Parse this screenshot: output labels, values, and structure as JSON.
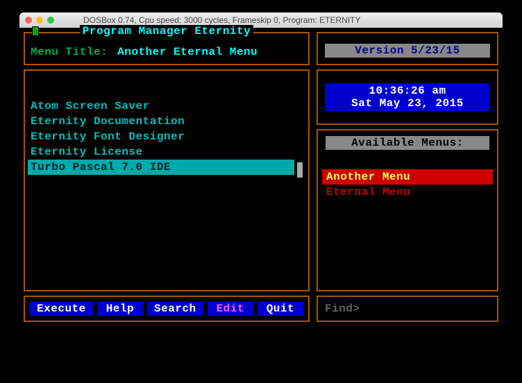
{
  "window": {
    "title": "DOSBox 0.74, Cpu speed:    3000 cycles, Frameskip  0, Program: ETERNITY"
  },
  "header": {
    "panel_title": "Program Manager Eternity",
    "menu_label": "Menu Title:",
    "menu_value": "Another Eternal Menu"
  },
  "list": {
    "items": [
      {
        "label": "Atom Screen Saver",
        "selected": false
      },
      {
        "label": "Eternity Documentation",
        "selected": false
      },
      {
        "label": "Eternity Font Designer",
        "selected": false
      },
      {
        "label": "Eternity License",
        "selected": false
      },
      {
        "label": "Turbo Pascal 7.0 IDE",
        "selected": true
      }
    ]
  },
  "buttons": {
    "execute": "Execute",
    "help": "Help",
    "search": "Search",
    "edit": "Edit",
    "quit": "Quit"
  },
  "version": {
    "text": "Version 5/23/15"
  },
  "clock": {
    "time": "10:36:26 am",
    "date": "Sat May 23, 2015"
  },
  "available": {
    "header": "Available Menus:",
    "items": [
      {
        "label": "Another Menu",
        "selected": true
      },
      {
        "label": "Eternal Menu",
        "selected": false
      }
    ]
  },
  "find": {
    "label": "Find>"
  }
}
